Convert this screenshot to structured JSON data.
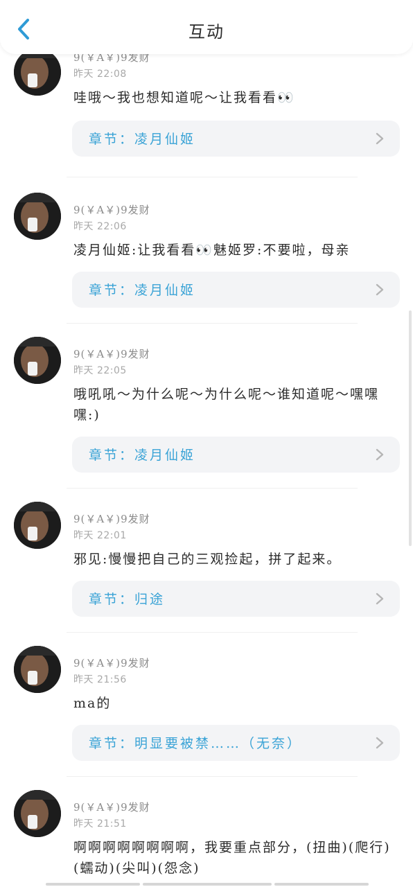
{
  "header": {
    "title": "互动"
  },
  "comments": [
    {
      "user": "9(￥A￥)9发财",
      "time": "昨天 22:08",
      "text": "哇哦～我也想知道呢～让我看看👀",
      "chapter": "章节：凌月仙姬"
    },
    {
      "user": "9(￥A￥)9发财",
      "time": "昨天 22:06",
      "text": "凌月仙姬:让我看看👀魅姬罗:不要啦，母亲",
      "chapter": "章节：凌月仙姬"
    },
    {
      "user": "9(￥A￥)9发财",
      "time": "昨天 22:05",
      "text": "哦吼吼～为什么呢～为什么呢～谁知道呢～嘿嘿嘿:)",
      "chapter": "章节：凌月仙姬"
    },
    {
      "user": "9(￥A￥)9发财",
      "time": "昨天 22:01",
      "text": "邪见:慢慢把自己的三观捡起，拼了起来。",
      "chapter": "章节：归途"
    },
    {
      "user": "9(￥A￥)9发财",
      "time": "昨天 21:56",
      "text": "ma的",
      "chapter": "章节：明显要被禁……（无奈）"
    },
    {
      "user": "9(￥A￥)9发财",
      "time": "昨天 21:51",
      "text": "啊啊啊啊啊啊啊啊，我要重点部分，(扭曲)(爬行)(蠕动)(尖叫)(怨念)",
      "chapter": ""
    }
  ],
  "icons": {
    "back": "chevron-left-icon",
    "chapter_arrow": "chevron-right-icon"
  },
  "colors": {
    "accent": "#2f9bd6",
    "chapter_text": "#3aa3d6",
    "card_bg": "#f3f4f6"
  }
}
